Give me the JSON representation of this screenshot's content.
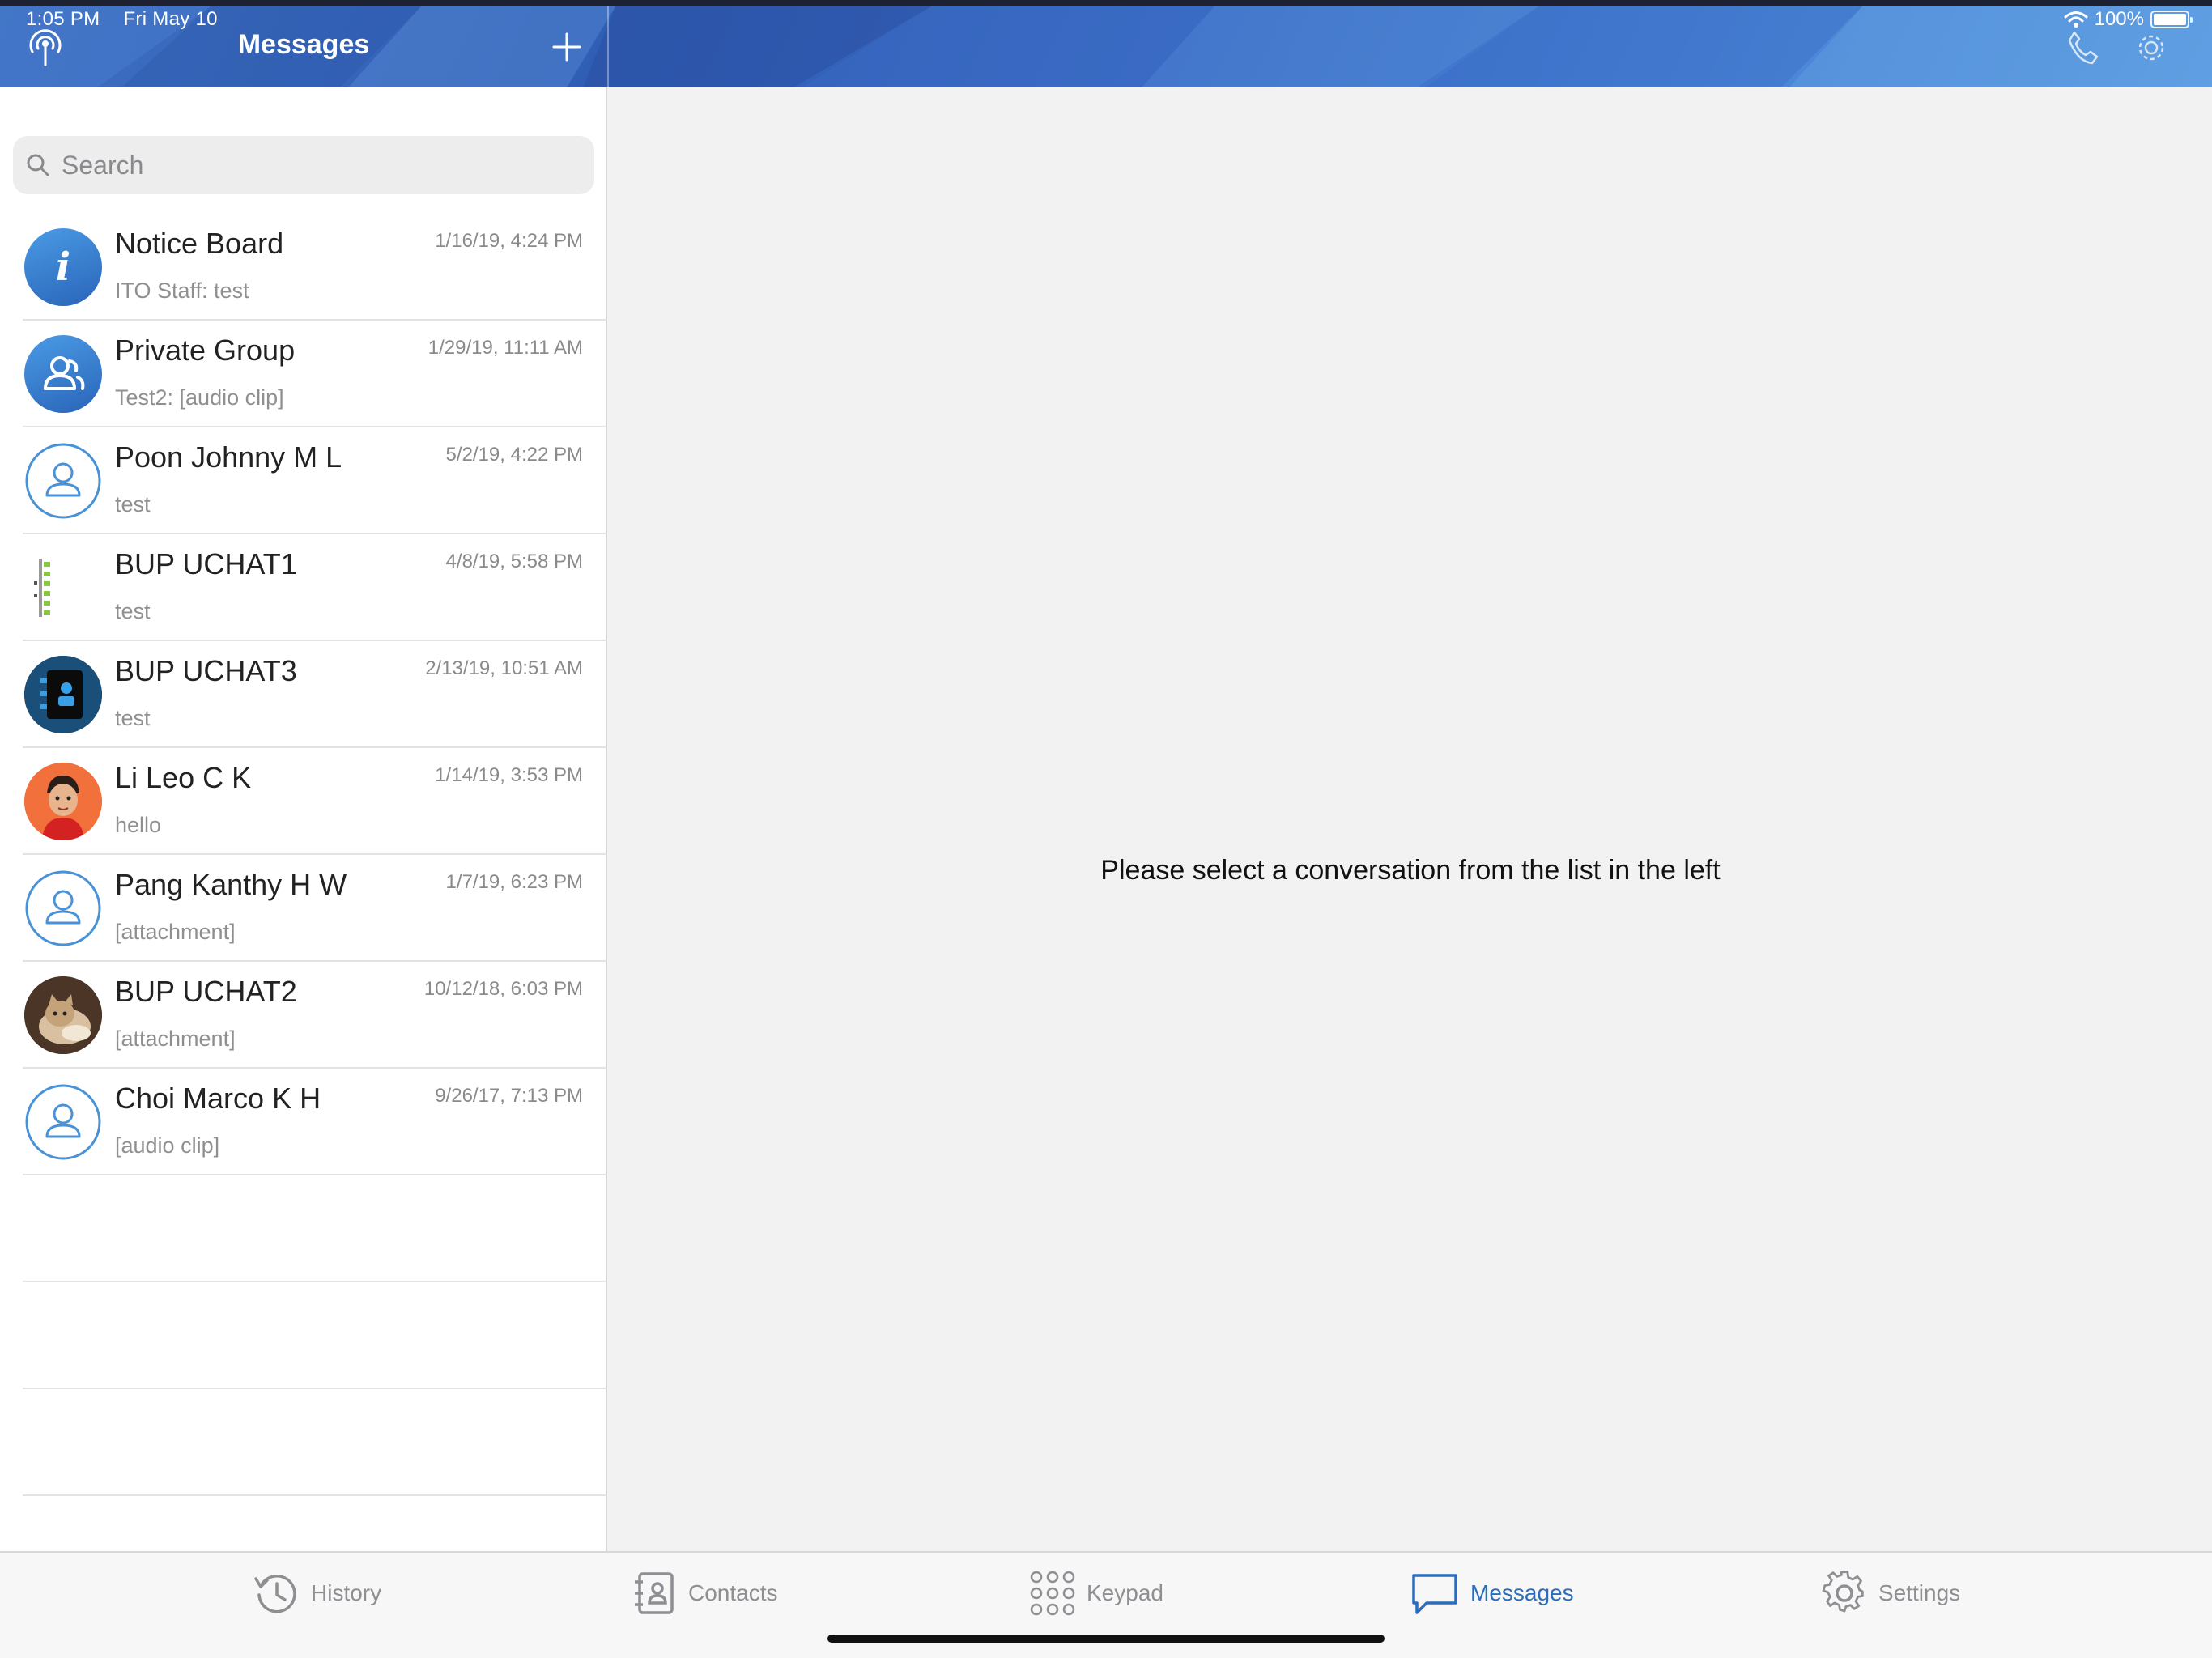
{
  "status": {
    "time": "1:05 PM",
    "date": "Fri May 10",
    "battery": "100%"
  },
  "header": {
    "title": "Messages"
  },
  "search": {
    "placeholder": "Search"
  },
  "conversations": [
    {
      "name": "Notice Board",
      "time": "1/16/19, 4:24 PM",
      "preview": "ITO Staff: test",
      "avatar": "info-icon"
    },
    {
      "name": "Private Group",
      "time": "1/29/19, 11:11 AM",
      "preview": "Test2: [audio clip]",
      "avatar": "group-icon"
    },
    {
      "name": "Poon Johnny M L",
      "time": "5/2/19, 4:22 PM",
      "preview": "test",
      "avatar": "person-outline-icon"
    },
    {
      "name": "BUP UCHAT1",
      "time": "4/8/19, 5:58 PM",
      "preview": "test",
      "avatar": "photo"
    },
    {
      "name": "BUP UCHAT3",
      "time": "2/13/19, 10:51 AM",
      "preview": "test",
      "avatar": "contact-book-icon"
    },
    {
      "name": "Li Leo C K",
      "time": "1/14/19, 3:53 PM",
      "preview": "hello",
      "avatar": "photo"
    },
    {
      "name": "Pang Kanthy H W",
      "time": "1/7/19, 6:23 PM",
      "preview": "[attachment]",
      "avatar": "person-outline-icon"
    },
    {
      "name": "BUP UCHAT2",
      "time": "10/12/18, 6:03 PM",
      "preview": "[attachment]",
      "avatar": "photo"
    },
    {
      "name": "Choi Marco K H",
      "time": "9/26/17, 7:13 PM",
      "preview": "[audio clip]",
      "avatar": "person-outline-icon"
    }
  ],
  "main": {
    "placeholder": "Please select a conversation from the list in the left"
  },
  "tabs": [
    {
      "label": "History",
      "icon": "history-icon"
    },
    {
      "label": "Contacts",
      "icon": "contacts-icon"
    },
    {
      "label": "Keypad",
      "icon": "keypad-icon"
    },
    {
      "label": "Messages",
      "icon": "message-icon",
      "active": true
    },
    {
      "label": "Settings",
      "icon": "gear-icon"
    }
  ],
  "colors": {
    "accent": "#2a6dbf",
    "header": "#3a6cc6",
    "inactive": "#8e8e93"
  }
}
